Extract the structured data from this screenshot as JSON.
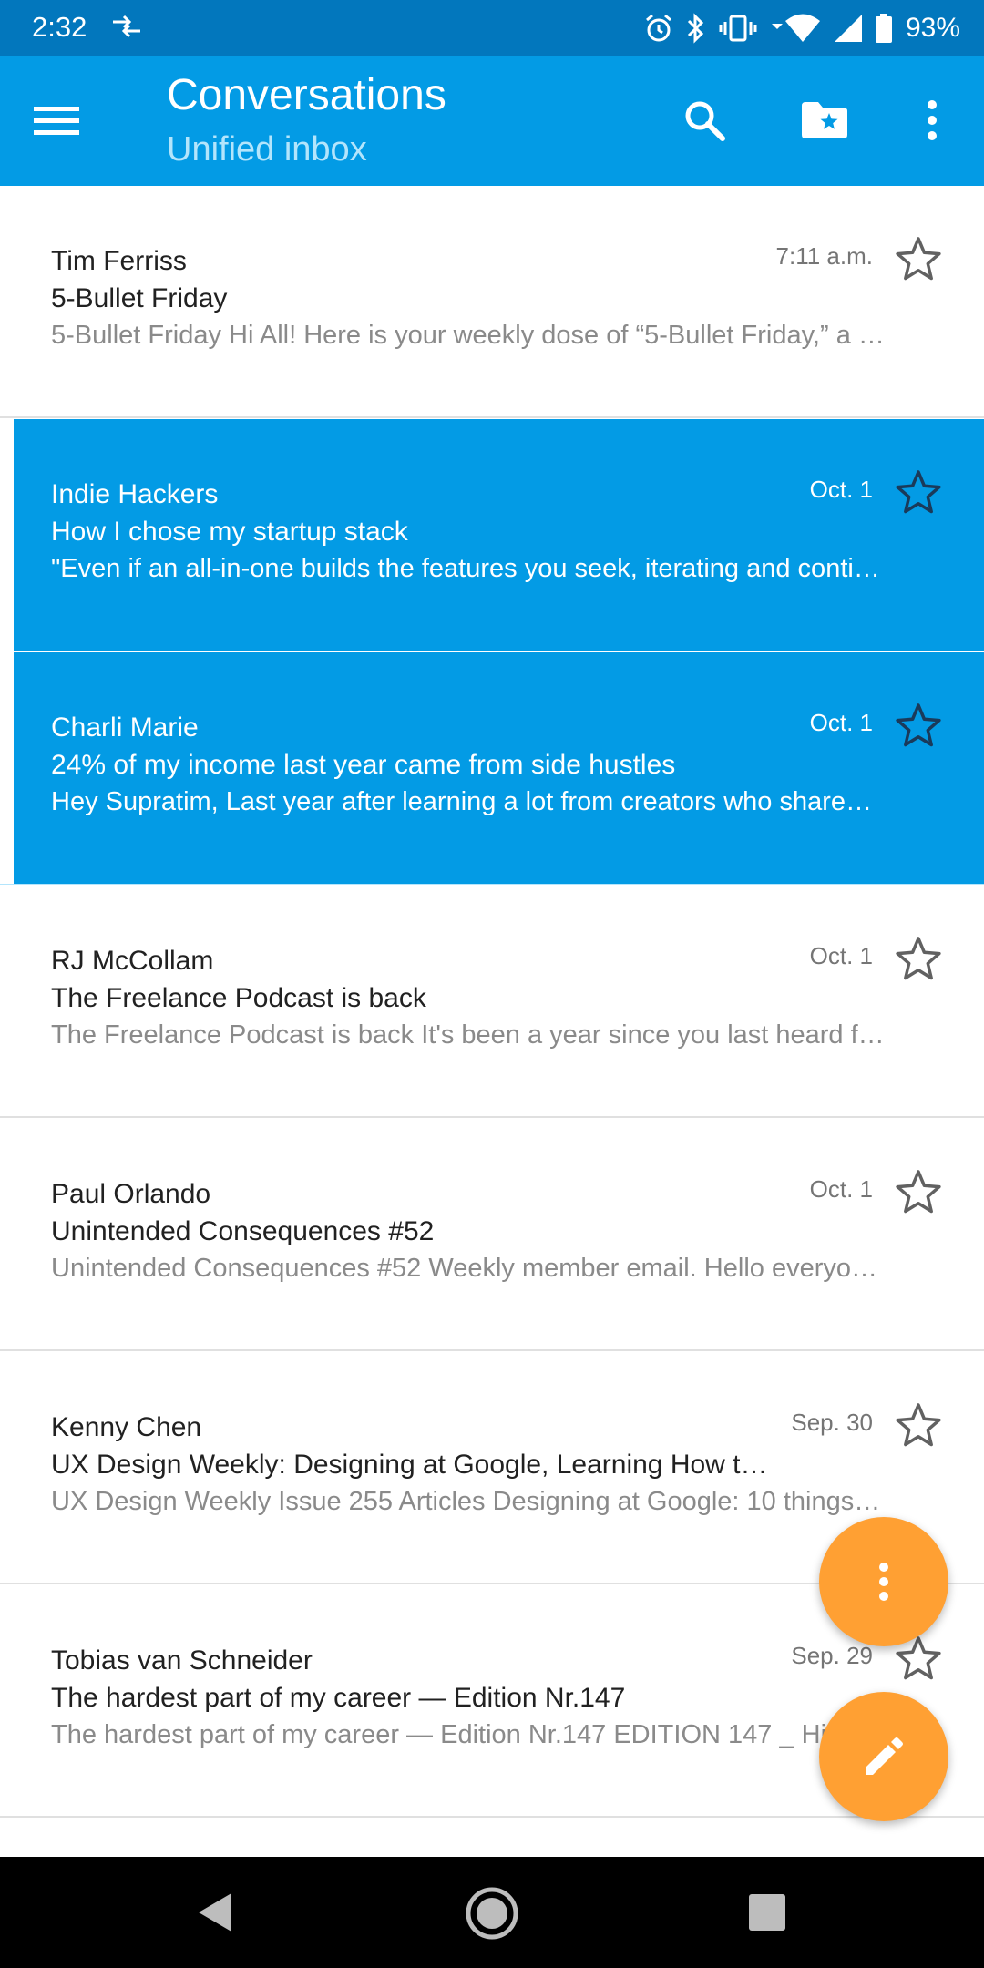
{
  "status_bar": {
    "time": "2:32",
    "battery": "93%",
    "icons": [
      "data-transfer-icon",
      "alarm-icon",
      "bluetooth-icon",
      "vibrate-icon",
      "wifi-icon",
      "signal-icon",
      "battery-icon"
    ]
  },
  "app_bar": {
    "title": "Conversations",
    "subtitle": "Unified inbox",
    "icons": [
      "menu-icon",
      "search-icon",
      "starred-folder-icon",
      "more-vert-icon"
    ],
    "color": "#039be5"
  },
  "messages": [
    {
      "sender": "Tim Ferriss",
      "subject": "5-Bullet Friday",
      "snippet": "5-Bullet Friday Hi All! Here is your weekly dose of “5-Bullet Friday,” a l…",
      "date": "7:11 a.m.",
      "selected": false,
      "starred": false
    },
    {
      "sender": "Indie Hackers",
      "subject": "How I chose my startup stack",
      "snippet": "\"Even if an all-in-one builds the features you seek, iterating and conti…",
      "date": "Oct. 1",
      "selected": true,
      "starred": false
    },
    {
      "sender": "Charli Marie",
      "subject": "24% of my income last year came from side hustles",
      "snippet": "Hey Supratim, Last year after learning a lot from creators who share…",
      "date": "Oct. 1",
      "selected": true,
      "starred": false
    },
    {
      "sender": "RJ McCollam",
      "subject": "The Freelance Podcast is back",
      "snippet": "The Freelance Podcast is back It's been a year since you last heard f…",
      "date": "Oct. 1",
      "selected": false,
      "starred": false
    },
    {
      "sender": "Paul Orlando",
      "subject": "Unintended Consequences #52",
      "snippet": "Unintended Consequences #52 Weekly member email. Hello everyo…",
      "date": "Oct. 1",
      "selected": false,
      "starred": false
    },
    {
      "sender": "Kenny Chen",
      "subject": "UX Design Weekly: Designing at Google, Learning How t…",
      "snippet": "UX Design Weekly Issue 255 Articles Designing at Google: 10 things…",
      "date": "Sep. 30",
      "selected": false,
      "starred": false
    },
    {
      "sender": "Tobias van Schneider",
      "subject": "The hardest part of my career — Edition Nr.147",
      "snippet": "The hardest part of my career — Edition Nr.147 EDITION 147 _ Hi",
      "date": "Sep. 29",
      "selected": false,
      "starred": false
    }
  ],
  "fabs": {
    "more_icon": "more-vert-icon",
    "compose_icon": "pencil-icon",
    "color": "#ffa033"
  },
  "nav_bar": {
    "icons": [
      "back-icon",
      "home-icon",
      "recents-icon"
    ]
  }
}
